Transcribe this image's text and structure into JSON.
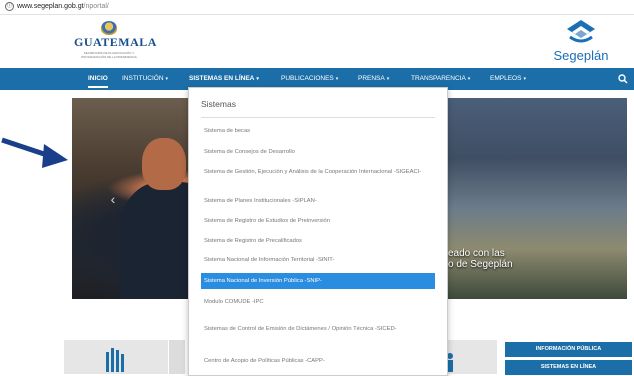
{
  "browser": {
    "info_icon": "ⓘ",
    "host": "www.segeplan.gob.gt",
    "path": "/nportal/"
  },
  "header": {
    "left_logo_word": "GUATEMALA",
    "left_logo_sub": "SECRETARÍA DE PLANIFICACIÓN Y PROGRAMACIÓN DE LA PRESIDENCIA",
    "right_logo_name": "Segeplán",
    "brand_color": "#1c6ea8"
  },
  "nav": {
    "items": [
      {
        "label": "INICIO",
        "caret": ""
      },
      {
        "label": "INSTITUCIÓN",
        "caret": "▾"
      },
      {
        "label": "SISTEMAS EN LÍNEA",
        "caret": "▾"
      },
      {
        "label": "PUBLICACIONES",
        "caret": "▾"
      },
      {
        "label": "PRENSA",
        "caret": "▾"
      },
      {
        "label": "TRANSPARENCIA",
        "caret": "▾"
      },
      {
        "label": "EMPLEOS",
        "caret": "▾"
      }
    ],
    "search_icon": "search-icon"
  },
  "hero": {
    "prev_glyph": "‹",
    "caption_line1": "eado con las",
    "caption_line2": "o de Segeplán"
  },
  "dropdown": {
    "title": "Sistemas",
    "items": [
      {
        "label": "Sistema de becas"
      },
      {
        "label": "Sistema de Consejos de Desarrollo"
      },
      {
        "label": "Sistema de Gestión, Ejecución y Análisis de la Cooperación Internacional -SIGEACI-"
      },
      {
        "label": "Sistema de Planes Institucionales -SIPLAN-"
      },
      {
        "label": "Sistema de Registro de Estudios de Preinversión"
      },
      {
        "label": "Sistema de Registro de Precalificados"
      },
      {
        "label": "Sistema Nacional de Información Territorial -SINIT-"
      },
      {
        "label": "Sistema Nacional de Inversión Pública -SNIP-"
      },
      {
        "label": "Modulo COMUDE -IPC"
      },
      {
        "label": "Sistemas de Control de Emisión de Dictámenes / Opinión Técnica -SICED-"
      },
      {
        "label": "Centro de Acopio de Políticas Públicas -CAPP-"
      }
    ],
    "selected_color": "#2b8de0"
  },
  "quick_links": {
    "btn1": "INFORMACIÓN PÚBLICA",
    "btn2": "SISTEMAS EN LÍNEA"
  },
  "annotation": {
    "arrow_color": "#1a3f8a"
  }
}
